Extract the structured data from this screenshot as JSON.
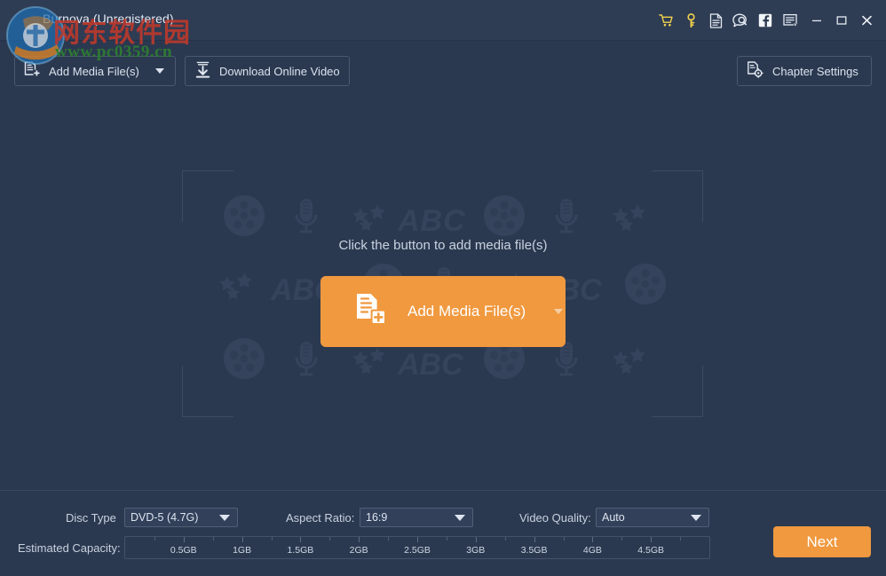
{
  "window": {
    "title": "Burnova (Unregistered)",
    "titlebar_icons": [
      {
        "name": "cart-icon",
        "label": "Buy"
      },
      {
        "name": "key-icon",
        "label": "Register"
      },
      {
        "name": "document-icon",
        "label": "Help Document"
      },
      {
        "name": "chat-bubble-icon",
        "label": "Support"
      },
      {
        "name": "facebook-icon",
        "label": "Facebook"
      },
      {
        "name": "feedback-icon",
        "label": "Feedback"
      },
      {
        "name": "minimize-icon",
        "label": "Minimize"
      },
      {
        "name": "maximize-icon",
        "label": "Maximize"
      },
      {
        "name": "close-icon",
        "label": "Close"
      }
    ]
  },
  "toolbar": {
    "add_media_label": "Add Media File(s)",
    "download_online_label": "Download Online Video",
    "chapter_settings_label": "Chapter Settings"
  },
  "dropzone": {
    "hint": "Click the button to add media file(s)",
    "add_media_label": "Add Media File(s)",
    "watermark_text": "ABC"
  },
  "bottom": {
    "disc_type_label": "Disc Type",
    "disc_type_value": "DVD-5 (4.7G)",
    "aspect_ratio_label": "Aspect Ratio:",
    "aspect_ratio_value": "16:9",
    "video_quality_label": "Video Quality:",
    "video_quality_value": "Auto",
    "capacity_label": "Estimated Capacity:",
    "capacity_ticks": [
      "0.5GB",
      "1GB",
      "1.5GB",
      "2GB",
      "2.5GB",
      "3GB",
      "3.5GB",
      "4GB",
      "4.5GB"
    ],
    "next_label": "Next"
  },
  "watermark": {
    "chinese": "网东软件园",
    "url": "www.pc0359.cn"
  },
  "colors": {
    "background": "#2b3950",
    "titlebar": "#2e3c54",
    "accent_orange": "#f0993f",
    "accent_yellow": "#f2d34a",
    "text": "#d7dde8",
    "border": "#4a5870"
  }
}
